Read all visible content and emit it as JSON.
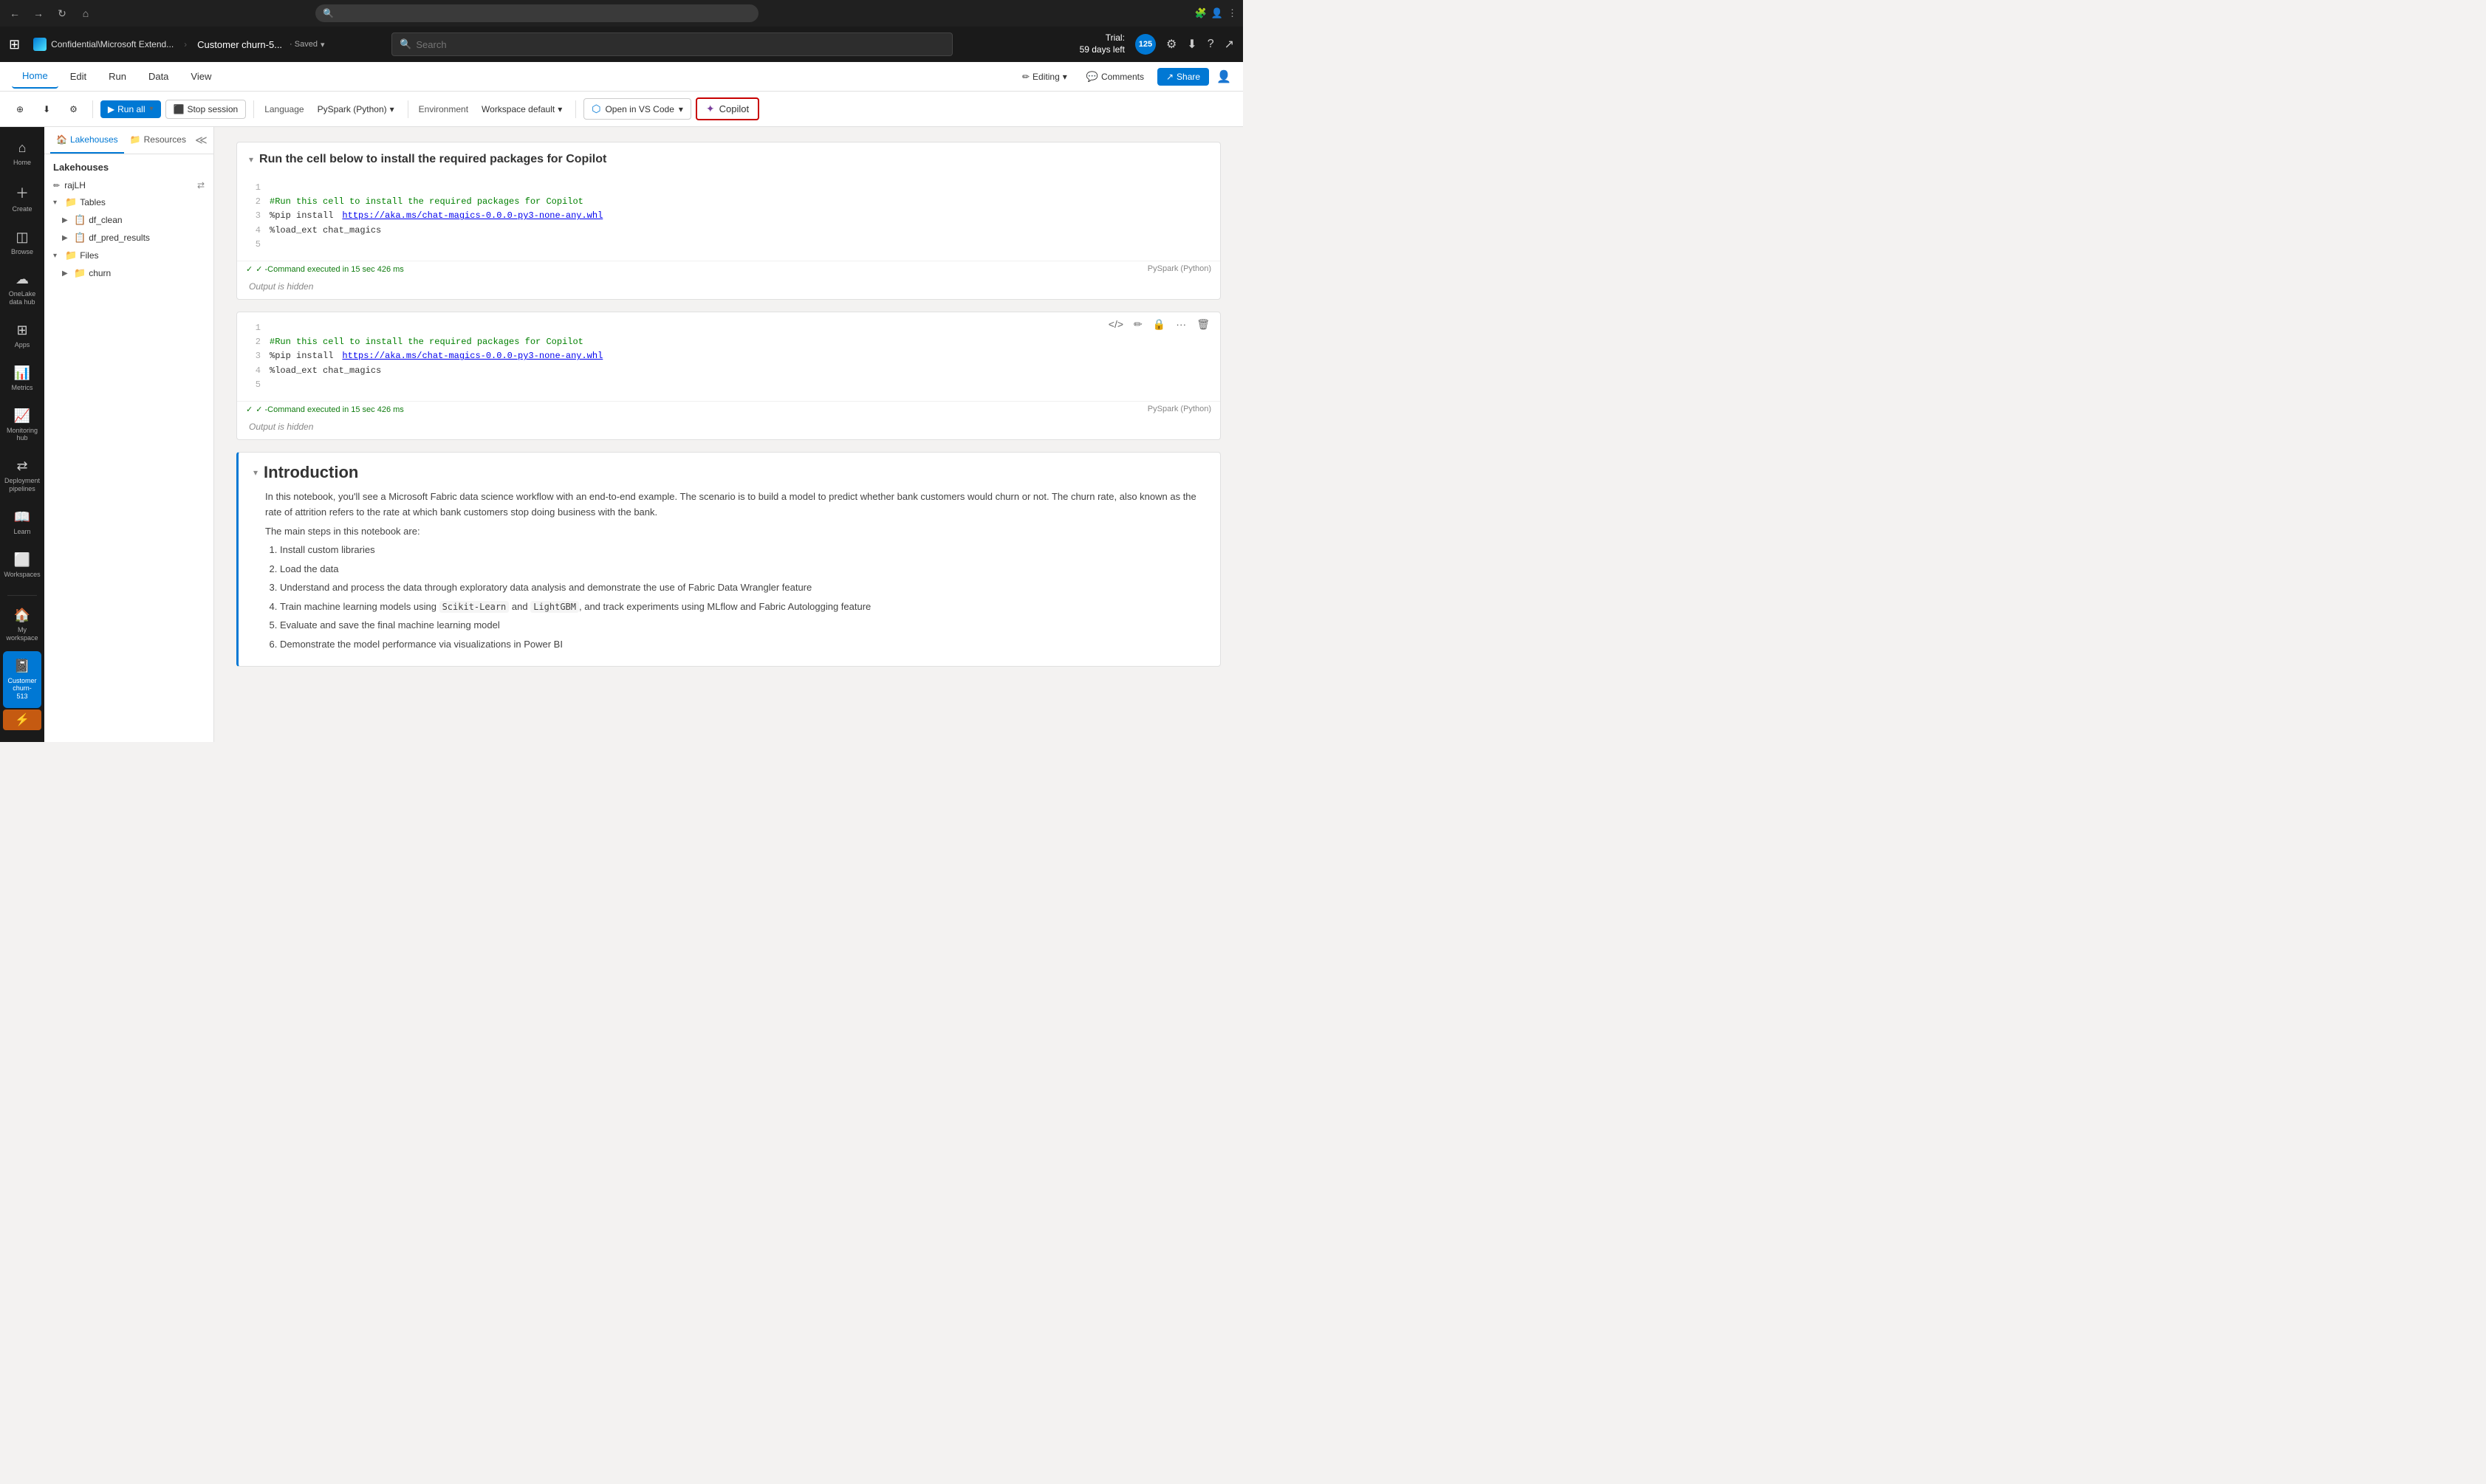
{
  "browser": {
    "url": "",
    "nav": {
      "back": "←",
      "forward": "→",
      "refresh": "↻",
      "home": "⌂"
    },
    "search_placeholder": "",
    "actions": [
      "☆",
      "⋮"
    ]
  },
  "appHeader": {
    "waffle": "⊞",
    "notebookTitle": "Customer churn-5...",
    "fabricLabel": "Confidential\\Microsoft Extend...",
    "saved": "· Saved",
    "savedDropdown": "▾",
    "searchPlaceholder": "Search",
    "trial": {
      "label": "Trial:",
      "days": "59 days left"
    },
    "avatarText": "125",
    "icons": {
      "settings": "⚙",
      "download": "⬇",
      "help": "?",
      "share2": "↗"
    }
  },
  "ribbonMenu": {
    "tabs": [
      "Home",
      "Edit",
      "Run",
      "Data",
      "View"
    ],
    "activeTab": "Home",
    "editing": "Editing",
    "editingDropdown": "▾",
    "comments": "Comments",
    "share": "Share",
    "shareIcon": "↗"
  },
  "toolbar": {
    "addCodeIcon": "⊕",
    "downloadIcon": "⬇",
    "settingsIcon": "⚙",
    "runAll": "Run all",
    "runDropdown": "▾",
    "stopSession": "Stop session",
    "language": "Language",
    "pySpark": "PySpark (Python)",
    "pySparkDropdown": "▾",
    "environment": "Environment",
    "workspaceDefault": "Workspace default",
    "workspaceDropdown": "▾",
    "openVSCode": "Open in VS Code",
    "openVSCodeDropdown": "▾",
    "copilot": "Copilot"
  },
  "sidebar": {
    "items": [
      {
        "id": "home",
        "icon": "⌂",
        "label": "Home"
      },
      {
        "id": "create",
        "icon": "+",
        "label": "Create"
      },
      {
        "id": "browse",
        "icon": "◫",
        "label": "Browse"
      },
      {
        "id": "onelake",
        "icon": "☁",
        "label": "OneLake\ndata hub"
      },
      {
        "id": "apps",
        "icon": "⊞",
        "label": "Apps"
      },
      {
        "id": "metrics",
        "icon": "📊",
        "label": "Metrics"
      },
      {
        "id": "monitoring",
        "icon": "👁",
        "label": "Monitoring\nhub"
      },
      {
        "id": "deployment",
        "icon": "🚀",
        "label": "Deployment\npipelines"
      },
      {
        "id": "learn",
        "icon": "📖",
        "label": "Learn"
      },
      {
        "id": "workspaces",
        "icon": "⬜",
        "label": "Workspaces"
      }
    ],
    "bottomItems": [
      {
        "id": "myworkspace",
        "icon": "🏠",
        "label": "My\nworkspace"
      },
      {
        "id": "customerchurn",
        "icon": "📓",
        "label": "Customer\nchurn-513"
      }
    ]
  },
  "fileExplorer": {
    "tabs": [
      {
        "label": "Lakehouses",
        "icon": "🏠",
        "active": true
      },
      {
        "label": "Resources",
        "icon": "📁",
        "active": false
      }
    ],
    "sectionTitle": "Lakehouses",
    "userName": "rajLH",
    "collapseIcon": "≪",
    "exchangeIcon": "⇄",
    "tree": {
      "tables": {
        "label": "Tables",
        "children": [
          {
            "label": "df_clean"
          },
          {
            "label": "df_pred_results"
          }
        ]
      },
      "files": {
        "label": "Files",
        "children": [
          {
            "label": "churn"
          }
        ]
      }
    }
  },
  "notebook": {
    "cell1": {
      "sectionTitle": "Run the cell below to install the required packages for Copilot",
      "lines": [
        {
          "num": "1",
          "type": "empty",
          "text": ""
        },
        {
          "num": "2",
          "type": "comment",
          "text": "#Run this cell to install the required packages for Copilot"
        },
        {
          "num": "3",
          "type": "code",
          "prefix": "%pip install ",
          "link": "https://aka.ms/chat-magics-0.0.0-py3-none-any.whl"
        },
        {
          "num": "4",
          "type": "code",
          "text": "%load_ext chat_magics"
        },
        {
          "num": "5",
          "type": "empty",
          "text": ""
        }
      ],
      "status": "✓ -Command executed in 15 sec 426 ms",
      "language": "PySpark (Python)",
      "outputHidden": "Output is hidden"
    },
    "cell2": {
      "lines": [
        {
          "num": "1",
          "type": "empty",
          "text": ""
        },
        {
          "num": "2",
          "type": "comment",
          "text": "#Run this cell to install the required packages for Copilot"
        },
        {
          "num": "3",
          "type": "code",
          "prefix": "%pip install ",
          "link": "https://aka.ms/chat-magics-0.0.0-py3-none-any.whl"
        },
        {
          "num": "4",
          "type": "code",
          "text": "%load_ext chat_magics"
        },
        {
          "num": "5",
          "type": "empty",
          "text": ""
        }
      ],
      "status": "✓ -Command executed in 15 sec 426 ms",
      "language": "PySpark (Python)",
      "outputHidden": "Output is hidden",
      "toolbarIcons": [
        "</>",
        "✏",
        "🔒",
        "...",
        "🗑"
      ]
    },
    "introduction": {
      "title": "Introduction",
      "paragraph1": "In this notebook, you'll see a Microsoft Fabric data science workflow with an end-to-end example. The scenario is to build a model to predict whether bank customers would churn or not. The churn rate, also known as the rate of attrition refers to the rate at which bank customers stop doing business with the bank.",
      "stepsHeader": "The main steps in this notebook are:",
      "steps": [
        "Install custom libraries",
        "Load the data",
        "Understand and process the data through exploratory data analysis and demonstrate the use of Fabric Data Wrangler feature",
        "Train machine learning models using Scikit-Learn and LightGBM, and track experiments using MLflow and Fabric Autologging feature",
        "Evaluate and save the final machine learning model",
        "Demonstrate the model performance via visualizations in Power BI"
      ]
    }
  }
}
